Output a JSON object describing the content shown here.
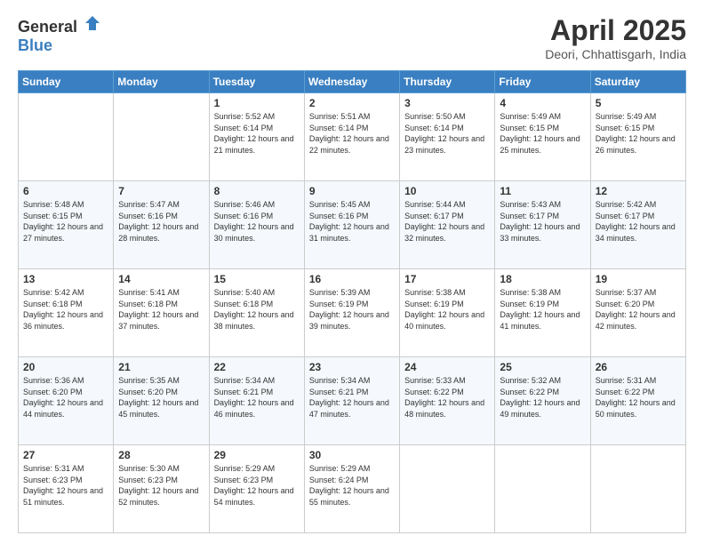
{
  "header": {
    "logo_general": "General",
    "logo_blue": "Blue",
    "month_title": "April 2025",
    "location": "Deori, Chhattisgarh, India"
  },
  "days_of_week": [
    "Sunday",
    "Monday",
    "Tuesday",
    "Wednesday",
    "Thursday",
    "Friday",
    "Saturday"
  ],
  "weeks": [
    [
      {
        "day": "",
        "info": ""
      },
      {
        "day": "",
        "info": ""
      },
      {
        "day": "1",
        "info": "Sunrise: 5:52 AM\nSunset: 6:14 PM\nDaylight: 12 hours and 21 minutes."
      },
      {
        "day": "2",
        "info": "Sunrise: 5:51 AM\nSunset: 6:14 PM\nDaylight: 12 hours and 22 minutes."
      },
      {
        "day": "3",
        "info": "Sunrise: 5:50 AM\nSunset: 6:14 PM\nDaylight: 12 hours and 23 minutes."
      },
      {
        "day": "4",
        "info": "Sunrise: 5:49 AM\nSunset: 6:15 PM\nDaylight: 12 hours and 25 minutes."
      },
      {
        "day": "5",
        "info": "Sunrise: 5:49 AM\nSunset: 6:15 PM\nDaylight: 12 hours and 26 minutes."
      }
    ],
    [
      {
        "day": "6",
        "info": "Sunrise: 5:48 AM\nSunset: 6:15 PM\nDaylight: 12 hours and 27 minutes."
      },
      {
        "day": "7",
        "info": "Sunrise: 5:47 AM\nSunset: 6:16 PM\nDaylight: 12 hours and 28 minutes."
      },
      {
        "day": "8",
        "info": "Sunrise: 5:46 AM\nSunset: 6:16 PM\nDaylight: 12 hours and 30 minutes."
      },
      {
        "day": "9",
        "info": "Sunrise: 5:45 AM\nSunset: 6:16 PM\nDaylight: 12 hours and 31 minutes."
      },
      {
        "day": "10",
        "info": "Sunrise: 5:44 AM\nSunset: 6:17 PM\nDaylight: 12 hours and 32 minutes."
      },
      {
        "day": "11",
        "info": "Sunrise: 5:43 AM\nSunset: 6:17 PM\nDaylight: 12 hours and 33 minutes."
      },
      {
        "day": "12",
        "info": "Sunrise: 5:42 AM\nSunset: 6:17 PM\nDaylight: 12 hours and 34 minutes."
      }
    ],
    [
      {
        "day": "13",
        "info": "Sunrise: 5:42 AM\nSunset: 6:18 PM\nDaylight: 12 hours and 36 minutes."
      },
      {
        "day": "14",
        "info": "Sunrise: 5:41 AM\nSunset: 6:18 PM\nDaylight: 12 hours and 37 minutes."
      },
      {
        "day": "15",
        "info": "Sunrise: 5:40 AM\nSunset: 6:18 PM\nDaylight: 12 hours and 38 minutes."
      },
      {
        "day": "16",
        "info": "Sunrise: 5:39 AM\nSunset: 6:19 PM\nDaylight: 12 hours and 39 minutes."
      },
      {
        "day": "17",
        "info": "Sunrise: 5:38 AM\nSunset: 6:19 PM\nDaylight: 12 hours and 40 minutes."
      },
      {
        "day": "18",
        "info": "Sunrise: 5:38 AM\nSunset: 6:19 PM\nDaylight: 12 hours and 41 minutes."
      },
      {
        "day": "19",
        "info": "Sunrise: 5:37 AM\nSunset: 6:20 PM\nDaylight: 12 hours and 42 minutes."
      }
    ],
    [
      {
        "day": "20",
        "info": "Sunrise: 5:36 AM\nSunset: 6:20 PM\nDaylight: 12 hours and 44 minutes."
      },
      {
        "day": "21",
        "info": "Sunrise: 5:35 AM\nSunset: 6:20 PM\nDaylight: 12 hours and 45 minutes."
      },
      {
        "day": "22",
        "info": "Sunrise: 5:34 AM\nSunset: 6:21 PM\nDaylight: 12 hours and 46 minutes."
      },
      {
        "day": "23",
        "info": "Sunrise: 5:34 AM\nSunset: 6:21 PM\nDaylight: 12 hours and 47 minutes."
      },
      {
        "day": "24",
        "info": "Sunrise: 5:33 AM\nSunset: 6:22 PM\nDaylight: 12 hours and 48 minutes."
      },
      {
        "day": "25",
        "info": "Sunrise: 5:32 AM\nSunset: 6:22 PM\nDaylight: 12 hours and 49 minutes."
      },
      {
        "day": "26",
        "info": "Sunrise: 5:31 AM\nSunset: 6:22 PM\nDaylight: 12 hours and 50 minutes."
      }
    ],
    [
      {
        "day": "27",
        "info": "Sunrise: 5:31 AM\nSunset: 6:23 PM\nDaylight: 12 hours and 51 minutes."
      },
      {
        "day": "28",
        "info": "Sunrise: 5:30 AM\nSunset: 6:23 PM\nDaylight: 12 hours and 52 minutes."
      },
      {
        "day": "29",
        "info": "Sunrise: 5:29 AM\nSunset: 6:23 PM\nDaylight: 12 hours and 54 minutes."
      },
      {
        "day": "30",
        "info": "Sunrise: 5:29 AM\nSunset: 6:24 PM\nDaylight: 12 hours and 55 minutes."
      },
      {
        "day": "",
        "info": ""
      },
      {
        "day": "",
        "info": ""
      },
      {
        "day": "",
        "info": ""
      }
    ]
  ]
}
